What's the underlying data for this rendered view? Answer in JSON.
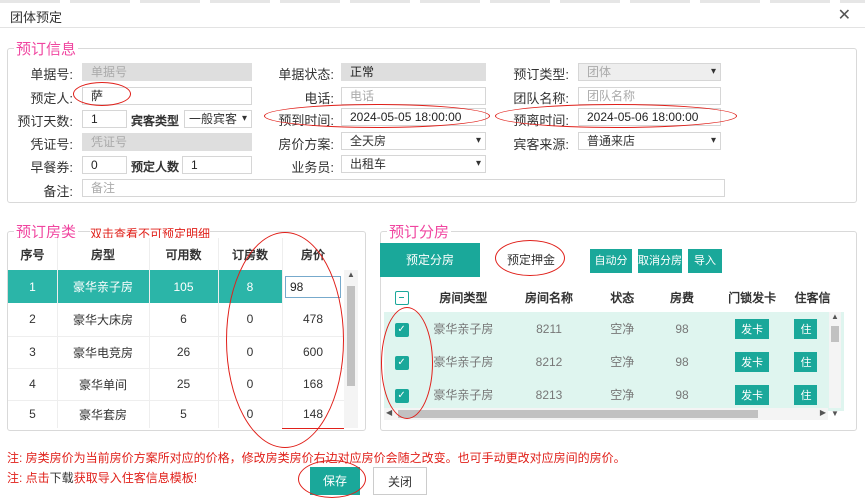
{
  "window": {
    "title": "团体预定"
  },
  "booking": {
    "legend": "预订信息",
    "doc_no": {
      "label": "单据号:",
      "placeholder": "单据号"
    },
    "doc_status": {
      "label": "单据状态:",
      "value": "正常"
    },
    "booking_type": {
      "label": "预订类型:",
      "value": "团体"
    },
    "booker": {
      "label": "预定人:",
      "value": "萨"
    },
    "phone": {
      "label": "电话:",
      "placeholder": "电话"
    },
    "group_name": {
      "label": "团队名称:",
      "placeholder": "团队名称"
    },
    "days": {
      "label": "预订天数:",
      "value": "1"
    },
    "guest_type": {
      "label": "宾客类型",
      "value": "一般宾客"
    },
    "arrival": {
      "label": "预到时间:",
      "value": "2024-05-05 18:00:00"
    },
    "departure": {
      "label": "预离时间:",
      "value": "2024-05-06 18:00:00"
    },
    "voucher": {
      "label": "凭证号:",
      "placeholder": "凭证号"
    },
    "price_plan": {
      "label": "房价方案:",
      "value": "全天房"
    },
    "guest_source": {
      "label": "宾客来源:",
      "value": "普通来店"
    },
    "breakfast": {
      "label": "早餐券:",
      "value": "0"
    },
    "headcount": {
      "label": "预定人数",
      "value": "1"
    },
    "salesman": {
      "label": "业务员:",
      "value": "出租车"
    },
    "remark": {
      "label": "备注:",
      "placeholder": "备注"
    }
  },
  "room_types": {
    "legend": "预订房类",
    "hint": "双击查看不可预定明细",
    "headers": [
      "序号",
      "房型",
      "可用数",
      "订房数",
      "房价"
    ],
    "rows": [
      {
        "no": "1",
        "type": "豪华亲子房",
        "avail": "105",
        "booked": "8",
        "price": "98"
      },
      {
        "no": "2",
        "type": "豪华大床房",
        "avail": "6",
        "booked": "0",
        "price": "478"
      },
      {
        "no": "3",
        "type": "豪华电竞房",
        "avail": "26",
        "booked": "0",
        "price": "600"
      },
      {
        "no": "4",
        "type": "豪华单间",
        "avail": "25",
        "booked": "0",
        "price": "168"
      },
      {
        "no": "5",
        "type": "豪华套房",
        "avail": "5",
        "booked": "0",
        "price": "148"
      }
    ]
  },
  "assign": {
    "legend": "预订分房",
    "tabs": [
      "预定分房",
      "预定押金"
    ],
    "buttons": [
      "自动分房",
      "取消分房",
      "导入"
    ],
    "headers": [
      "房间类型",
      "房间名称",
      "状态",
      "房费",
      "门锁发卡",
      "住客信"
    ],
    "rows": [
      {
        "type": "豪华亲子房",
        "name": "8211",
        "status": "空净",
        "fee": "98",
        "card": "发卡",
        "guest": "住"
      },
      {
        "type": "豪华亲子房",
        "name": "8212",
        "status": "空净",
        "fee": "98",
        "card": "发卡",
        "guest": "住"
      },
      {
        "type": "豪华亲子房",
        "name": "8213",
        "status": "空净",
        "fee": "98",
        "card": "发卡",
        "guest": "住"
      }
    ]
  },
  "notes": {
    "n1": "注: 房类房价为当前房价方案所对应的价格，修改房类房价右边对应房价会随之改变。也可手动更改对应房间的房价。",
    "n2_pre": "注: 点击",
    "n2_link": "下载",
    "n2_post": "获取导入住客信息模板!"
  },
  "footer": {
    "save": "保存",
    "close": "关闭"
  },
  "colors": {
    "accent": "#1aa89a",
    "legend": "#f046a0",
    "warn": "#e0201a"
  }
}
